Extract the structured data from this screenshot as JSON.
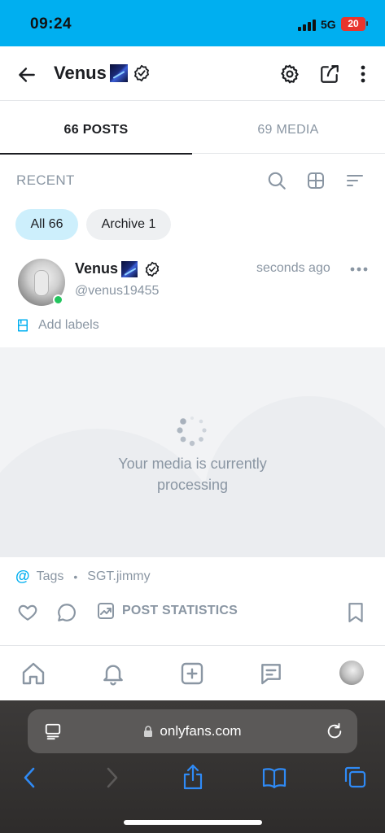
{
  "status_bar": {
    "time": "09:24",
    "network": "5G",
    "battery": "20"
  },
  "header": {
    "name": "Venus"
  },
  "tabs": [
    {
      "label": "66 POSTS",
      "active": true
    },
    {
      "label": "69 MEDIA",
      "active": false
    }
  ],
  "section": {
    "title": "RECENT"
  },
  "filters": [
    {
      "label": "All 66",
      "selected": true
    },
    {
      "label": "Archive 1",
      "selected": false
    }
  ],
  "post": {
    "name": "Venus",
    "handle": "@venus19455",
    "time": "seconds ago",
    "add_labels": "Add labels",
    "media_message": "Your media is currently processing",
    "tags_label": "Tags",
    "tagged_user": "SGT.jimmy",
    "stats_label": "POST STATISTICS"
  },
  "browser": {
    "url": "onlyfans.com"
  },
  "icons": [
    "back-arrow-icon",
    "verified-icon",
    "gear-icon",
    "share-icon",
    "more-vertical-icon",
    "search-icon",
    "grid-icon",
    "sort-icon",
    "more-horizontal-icon",
    "label-icon",
    "spinner-icon",
    "at-icon",
    "heart-icon",
    "comment-icon",
    "stats-icon",
    "bookmark-icon",
    "home-icon",
    "bell-icon",
    "add-icon",
    "messages-icon",
    "reader-icon",
    "lock-icon",
    "reload-icon",
    "chevron-left-icon",
    "chevron-right-icon",
    "share-up-icon",
    "book-icon",
    "tabs-icon"
  ],
  "colors": {
    "status_bar": "#00aff0",
    "accent": "#00aff0",
    "chip_selected": "#cdeffc",
    "online": "#22c55e",
    "battery": "#e8352d",
    "muted_text": "#8a96a3"
  }
}
